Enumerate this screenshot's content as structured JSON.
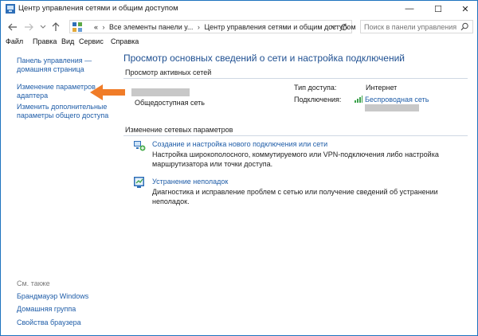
{
  "window": {
    "title": "Центр управления сетями и общим доступом",
    "min_glyph": "—",
    "max_glyph": "☐",
    "close_glyph": "✕"
  },
  "address": {
    "crumb_prefix": "«",
    "crumbs": [
      "Все элементы панели у...",
      "Центр управления сетями и общим доступом"
    ],
    "separator": "›",
    "search_placeholder": "Поиск в панели управления"
  },
  "menu": [
    "Файл",
    "Правка",
    "Вид",
    "Сервис",
    "Справка"
  ],
  "sidebar": {
    "home": [
      "Панель управления —",
      "домашняя страница"
    ],
    "adapter": [
      "Изменение параметров",
      "адаптера"
    ],
    "sharing": [
      "Изменить дополнительные",
      "параметры общего доступа"
    ],
    "see_also": "См. также",
    "links": [
      "Брандмауэр Windows",
      "Домашняя группа",
      "Свойства браузера"
    ]
  },
  "main": {
    "heading": "Просмотр основных сведений о сети и настройка подключений",
    "active_networks_label": "Просмотр активных сетей",
    "network_type": "Общедоступная сеть",
    "access_type_label": "Тип доступа:",
    "access_type_value": "Интернет",
    "connections_label": "Подключения:",
    "connection_value": "Беспроводная сеть",
    "change_settings_label": "Изменение сетевых параметров",
    "tasks": [
      {
        "icon": "network-setup-icon",
        "title": "Создание и настройка нового подключения или сети",
        "desc": [
          "Настройка широкополосного, коммутируемого или VPN-подключения либо настройка",
          "маршрутизатора или точки доступа."
        ]
      },
      {
        "icon": "troubleshoot-icon",
        "title": "Устранение неполадок",
        "desc": [
          "Диагностика и исправление проблем с сетью или получение сведений об устранении",
          "неполадок."
        ]
      }
    ]
  },
  "colors": {
    "link": "#1f5da8",
    "heading": "#1e4f91",
    "arrow": "#f07c28",
    "window_border": "#1e73be"
  }
}
